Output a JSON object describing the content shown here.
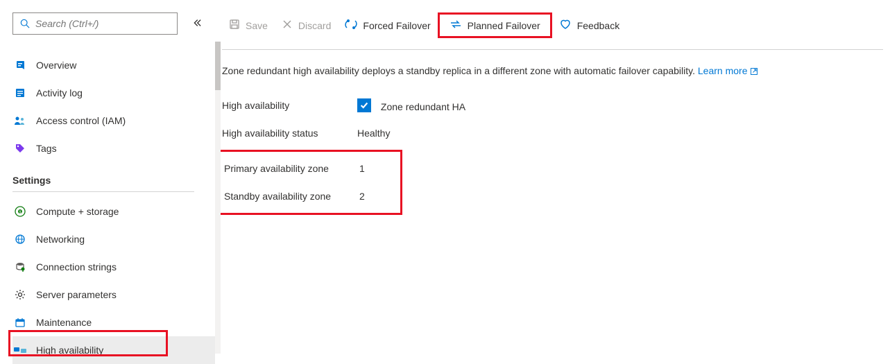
{
  "search": {
    "placeholder": "Search (Ctrl+/)"
  },
  "nav": {
    "item0": "Overview",
    "item1": "Activity log",
    "item2": "Access control (IAM)",
    "item3": "Tags"
  },
  "settingsHeader": "Settings",
  "settings": {
    "item0": "Compute + storage",
    "item1": "Networking",
    "item2": "Connection strings",
    "item3": "Server parameters",
    "item4": "Maintenance",
    "item5": "High availability"
  },
  "toolbar": {
    "save": "Save",
    "discard": "Discard",
    "forced": "Forced Failover",
    "planned": "Planned Failover",
    "feedback": "Feedback"
  },
  "desc": {
    "text": "Zone redundant high availability deploys a standby replica in a different zone with automatic failover capability. ",
    "learn": "Learn more"
  },
  "form": {
    "haLabel": "High availability",
    "haCheckbox": "Zone redundant HA",
    "statusLabel": "High availability status",
    "statusValue": "Healthy",
    "primaryLabel": "Primary availability zone",
    "primaryValue": "1",
    "standbyLabel": "Standby availability zone",
    "standbyValue": "2"
  }
}
